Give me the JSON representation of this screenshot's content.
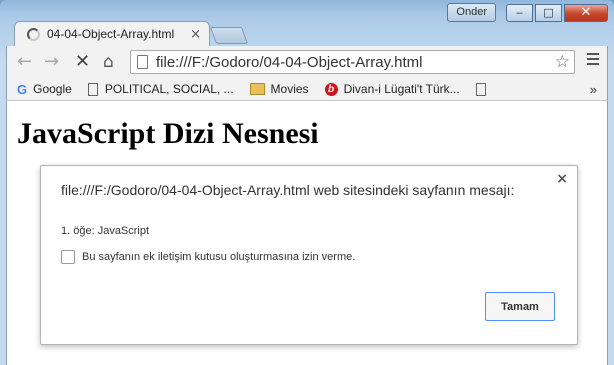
{
  "window": {
    "user_button_label": "Onder",
    "minimize_glyph": "‒",
    "maximize_glyph": "□",
    "close_glyph": "✕"
  },
  "tab": {
    "title": "04-04-Object-Array.html",
    "close_glyph": "×"
  },
  "toolbar": {
    "back_glyph": "←",
    "forward_glyph": "→",
    "stop_glyph": "✕",
    "home_glyph": "⌂",
    "url": "file:///F:/Godoro/04-04-Object-Array.html",
    "star_glyph": "☆"
  },
  "bookmarks": {
    "items": [
      {
        "label": "Google",
        "icon": "google-icon"
      },
      {
        "label": "POLITICAL, SOCIAL, ...",
        "icon": "page-icon"
      },
      {
        "label": "Movies",
        "icon": "folder-icon"
      },
      {
        "label": "Divan-i Lügati't Türk...",
        "icon": "divan-icon"
      },
      {
        "label": "",
        "icon": "page-icon"
      }
    ],
    "more_glyph": "»"
  },
  "page": {
    "heading": "JavaScript Dizi Nesnesi"
  },
  "dialog": {
    "title": "file:///F:/Godoro/04-04-Object-Array.html web sitesindeki sayfanın mesajı:",
    "message": "1. öğe: JavaScript",
    "checkbox_label": "Bu sayfanın ek iletişim kutusu oluşturmasına izin verme.",
    "checkbox_checked": false,
    "ok_label": "Tamam",
    "close_glyph": "×"
  },
  "colors": {
    "accent": "#4d90fe",
    "frame": "#a9c8e6"
  }
}
